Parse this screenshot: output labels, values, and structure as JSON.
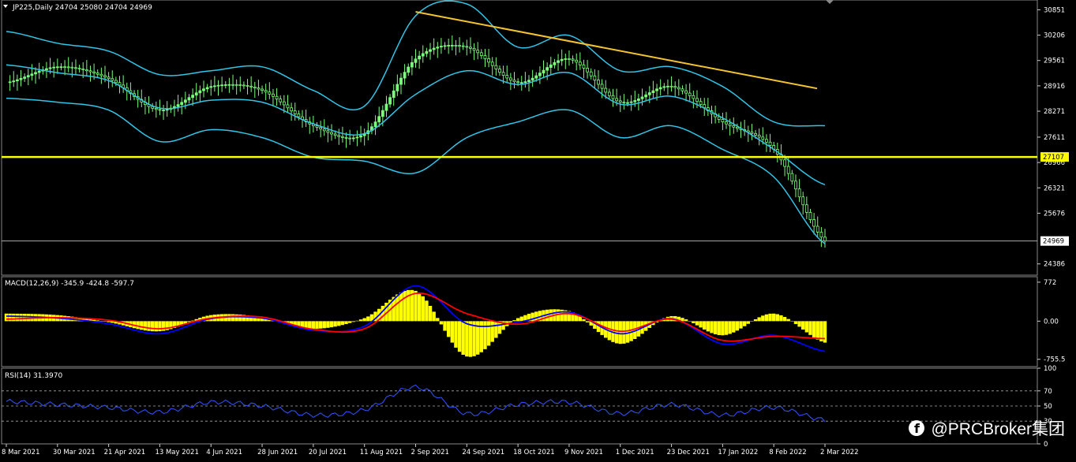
{
  "colors": {
    "background": "#000000",
    "candle": "#7CFC7C",
    "bands": "#33C4E6",
    "trendline": "#F4C430",
    "support": "#FFFF00",
    "macd_hist": "#FFFF00",
    "macd_main": "#0000FF",
    "macd_signal": "#FF0000",
    "rsi": "#3355FF",
    "axis_text": "#FFFFFF",
    "grid": "#555555"
  },
  "main_panel": {
    "header": "JP225,Daily  24704 25080 24704 24969",
    "y_ticks": [
      "30851",
      "30206",
      "29561",
      "28916",
      "28271",
      "27611",
      "26966",
      "26321",
      "25676",
      "24386"
    ],
    "support_label": "27107",
    "price_label": "24969"
  },
  "macd_panel": {
    "header": "MACD(12,26,9) -345.9 -424.8 -597.7",
    "y_ticks": [
      "772",
      "0.00",
      "-755.5"
    ]
  },
  "rsi_panel": {
    "header": "RSI(14) 31.3970",
    "y_ticks": [
      "100",
      "70",
      "50",
      "30",
      "0"
    ]
  },
  "x_axis": {
    "labels": [
      "8 Mar 2021",
      "30 Mar 2021",
      "21 Apr 2021",
      "13 May 2021",
      "4 Jun 2021",
      "28 Jun 2021",
      "20 Jul 2021",
      "11 Aug 2021",
      "2 Sep 2021",
      "24 Sep 2021",
      "18 Oct 2021",
      "9 Nov 2021",
      "1 Dec 2021",
      "23 Dec 2021",
      "17 Jan 2022",
      "8 Feb 2022",
      "2 Mar 2022"
    ]
  },
  "watermark": {
    "text": "@PRCBroker集团",
    "icon": "facebook-icon"
  },
  "chart_data": [
    {
      "type": "line",
      "name": "JP225 Daily price with Bollinger Bands",
      "ylim": [
        24100,
        31100
      ],
      "x": [
        "8 Mar 2021",
        "30 Mar 2021",
        "21 Apr 2021",
        "13 May 2021",
        "4 Jun 2021",
        "28 Jun 2021",
        "20 Jul 2021",
        "11 Aug 2021",
        "2 Sep 2021",
        "24 Sep 2021",
        "18 Oct 2021",
        "9 Nov 2021",
        "1 Dec 2021",
        "23 Dec 2021",
        "17 Jan 2022",
        "8 Feb 2022",
        "2 Mar 2022"
      ],
      "series": [
        {
          "name": "close",
          "values": [
            29000,
            29400,
            29100,
            28300,
            28900,
            28800,
            27900,
            27700,
            29600,
            29900,
            29000,
            29600,
            28500,
            28900,
            28000,
            27300,
            24969
          ]
        },
        {
          "name": "upper band",
          "values": [
            30300,
            30000,
            29800,
            29200,
            29300,
            29400,
            28800,
            28400,
            30700,
            31000,
            29900,
            30200,
            29300,
            29400,
            28900,
            28000,
            27900
          ]
        },
        {
          "name": "lower band",
          "values": [
            28600,
            28500,
            28300,
            27500,
            27800,
            27600,
            27100,
            27000,
            26700,
            27600,
            28000,
            28300,
            27600,
            27900,
            27300,
            26600,
            24900
          ]
        }
      ],
      "trendline": {
        "start": [
          "2 Sep 2021",
          30800
        ],
        "end": [
          "2 Mar 2022",
          28850
        ]
      },
      "support_level": 27107,
      "last_price": 24969
    },
    {
      "type": "bar",
      "name": "MACD(12,26,9)",
      "ylim": [
        -900,
        880
      ],
      "categories": [
        "8 Mar 2021",
        "30 Mar 2021",
        "21 Apr 2021",
        "13 May 2021",
        "4 Jun 2021",
        "28 Jun 2021",
        "20 Jul 2021",
        "11 Aug 2021",
        "2 Sep 2021",
        "24 Sep 2021",
        "18 Oct 2021",
        "9 Nov 2021",
        "1 Dec 2021",
        "23 Dec 2021",
        "17 Jan 2022",
        "8 Feb 2022",
        "2 Mar 2022"
      ],
      "series": [
        {
          "name": "histogram",
          "values": [
            150,
            120,
            -20,
            -200,
            120,
            80,
            -150,
            60,
            600,
            -700,
            60,
            200,
            -450,
            100,
            -280,
            150,
            -424.8
          ]
        },
        {
          "name": "main",
          "values": [
            100,
            60,
            -50,
            -250,
            50,
            60,
            -180,
            -100,
            700,
            -50,
            -20,
            180,
            -250,
            50,
            -450,
            -280,
            -597.7
          ]
        },
        {
          "name": "signal",
          "values": [
            40,
            70,
            20,
            -150,
            60,
            80,
            -160,
            -150,
            550,
            150,
            -60,
            150,
            -200,
            40,
            -380,
            -300,
            -345.9
          ]
        }
      ]
    },
    {
      "type": "line",
      "name": "RSI(14)",
      "ylim": [
        0,
        100
      ],
      "levels": [
        30,
        50,
        70
      ],
      "x": [
        "8 Mar 2021",
        "30 Mar 2021",
        "21 Apr 2021",
        "13 May 2021",
        "4 Jun 2021",
        "28 Jun 2021",
        "20 Jul 2021",
        "11 Aug 2021",
        "2 Sep 2021",
        "24 Sep 2021",
        "18 Oct 2021",
        "9 Nov 2021",
        "1 Dec 2021",
        "23 Dec 2021",
        "17 Jan 2022",
        "8 Feb 2022",
        "2 Mar 2022"
      ],
      "series": [
        {
          "name": "RSI",
          "values": [
            56,
            52,
            48,
            42,
            55,
            50,
            38,
            45,
            75,
            40,
            52,
            55,
            40,
            52,
            38,
            48,
            31.397
          ]
        }
      ]
    }
  ]
}
